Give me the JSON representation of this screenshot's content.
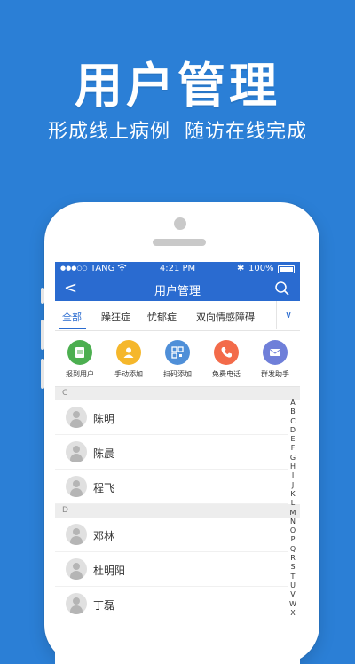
{
  "promo": {
    "headline": "用户管理",
    "subline": "形成线上病例  随访在线完成"
  },
  "statusbar": {
    "signal": "●●●○○",
    "carrier": "TANG",
    "time": "4:21 PM",
    "bluetooth": "✱",
    "battery": "100%"
  },
  "navbar": {
    "back": "<",
    "title": "用户管理"
  },
  "tabs": [
    {
      "label": "全部",
      "active": true
    },
    {
      "label": "躁狂症"
    },
    {
      "label": "忧郁症"
    },
    {
      "label": "双向情感障碍"
    }
  ],
  "tab_dropdown": "∨",
  "actions": [
    {
      "label": "报到用户",
      "color": "#4caf50"
    },
    {
      "label": "手动添加",
      "color": "#f5b72b"
    },
    {
      "label": "扫码添加",
      "color": "#4f8fd8"
    },
    {
      "label": "免费电话",
      "color": "#f36b4a"
    },
    {
      "label": "群发助手",
      "color": "#6f7fd9"
    }
  ],
  "sections": [
    {
      "letter": "C",
      "names": [
        "陈明",
        "陈晨",
        "程飞"
      ]
    },
    {
      "letter": "D",
      "names": [
        "邓林",
        "杜明阳",
        "丁磊"
      ]
    }
  ],
  "index_letters": [
    "A",
    "B",
    "C",
    "D",
    "E",
    "F",
    "G",
    "H",
    "I",
    "J",
    "K",
    "L",
    "M",
    "N",
    "O",
    "P",
    "Q",
    "R",
    "S",
    "T",
    "U",
    "V",
    "W",
    "X"
  ]
}
